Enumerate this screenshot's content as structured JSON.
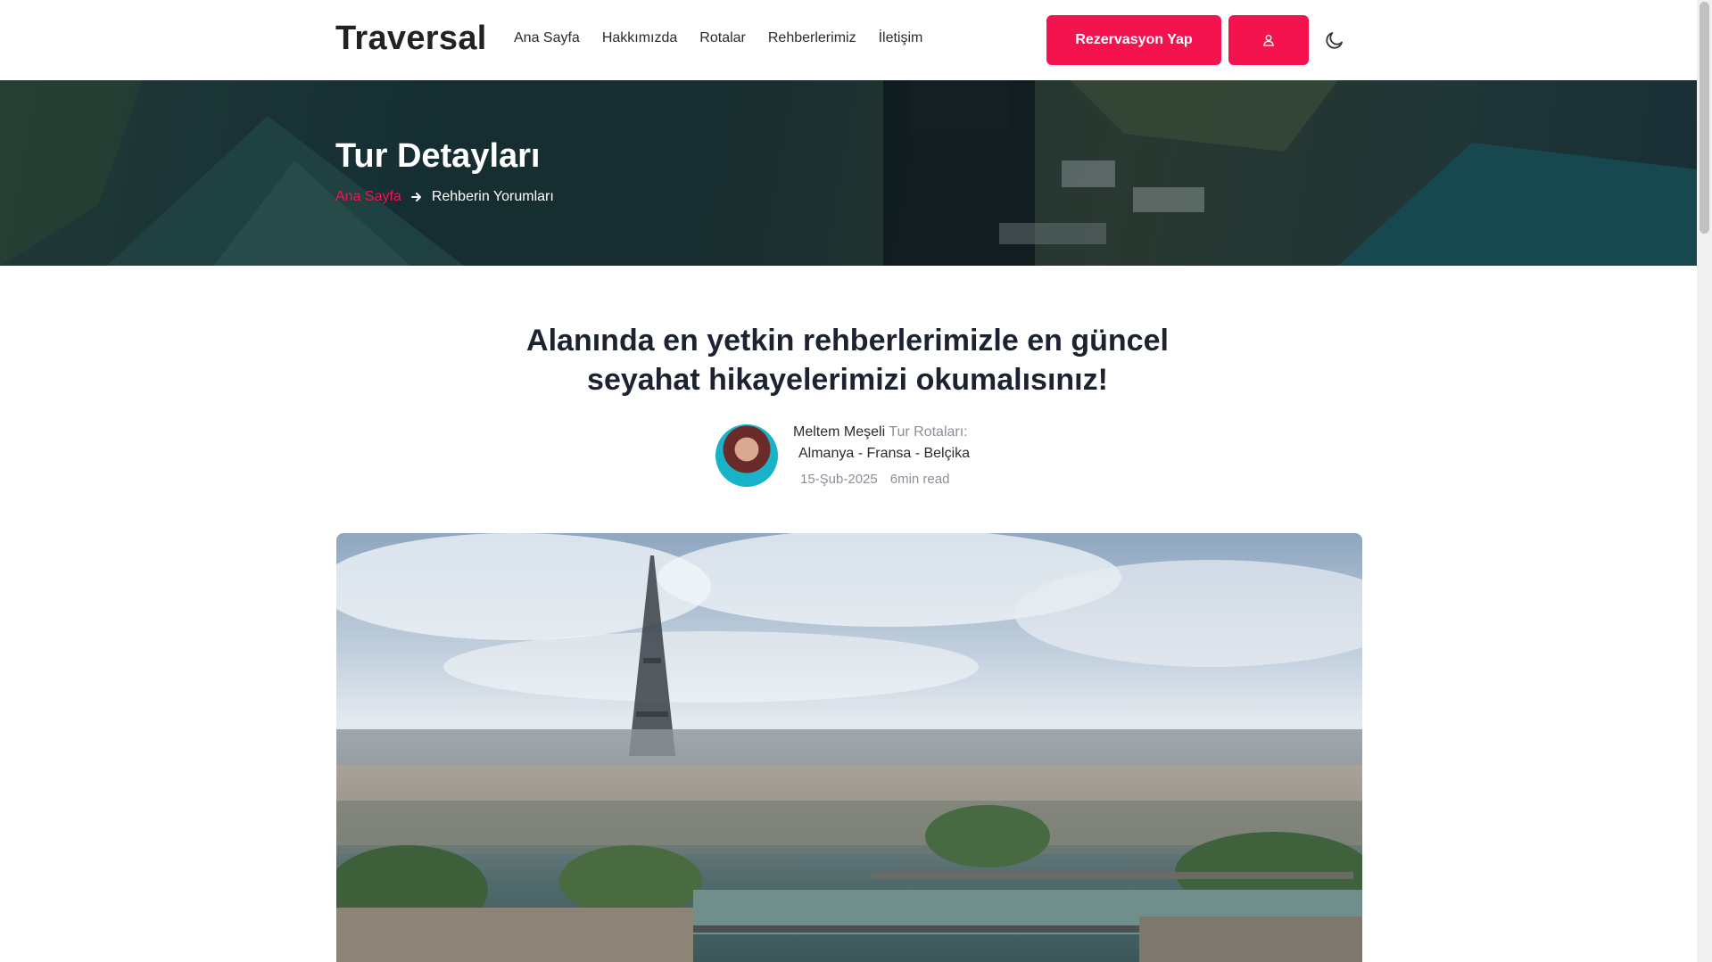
{
  "header": {
    "logo": "Traversal",
    "nav": [
      "Ana Sayfa",
      "Hakkımızda",
      "Rotalar",
      "Rehberlerimiz",
      "İletişim"
    ],
    "reserve_label": "Rezervasyon Yap",
    "user_icon": "user-icon",
    "theme_icon": "moon-icon"
  },
  "hero": {
    "title": "Tur Detayları",
    "breadcrumb": {
      "home": "Ana Sayfa",
      "current": "Rehberin Yorumları"
    }
  },
  "article": {
    "title_line1": "Alanında en yetkin rehberlerimizle en güncel",
    "title_line2": "seyahat hikayelerimizi okumalısınız!",
    "author_name": "Meltem Meşeli",
    "route_label": "Tur Rotaları:",
    "route": "Almanya - Fransa - Belçika",
    "date": "15-Şub-2025",
    "read_time": "6min read"
  },
  "colors": {
    "accent": "#f5134f",
    "text": "#1c2230",
    "muted": "#8a8f98"
  }
}
